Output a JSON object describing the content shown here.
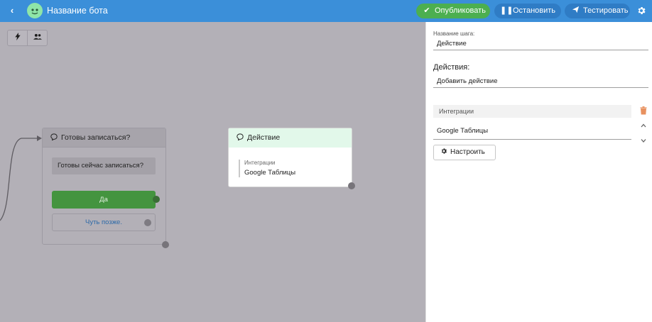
{
  "header": {
    "back_icon": "‹",
    "bot_name": "Название бота",
    "publish_label": "Опубликовать",
    "stop_label": "Остановить",
    "test_label": "Тестировать",
    "accent": "#3b8fd9",
    "publish_color": "#4caf50"
  },
  "toolbar": {
    "icons": [
      "lightning-icon",
      "users-icon"
    ]
  },
  "nodes": {
    "ready": {
      "title": "Готовы записаться?",
      "message": "Готовы сейчас записаться?",
      "yes_label": "Да",
      "later_label": "Чуть позже."
    },
    "action": {
      "title": "Действие",
      "integration_label": "Интеграции",
      "integration_value": "Google Таблицы"
    }
  },
  "panel": {
    "step_name_label": "Название шага:",
    "step_name_value": "Действие",
    "actions_label": "Действия:",
    "add_action": "Добавить действие",
    "integrations_label": "Интеграции",
    "integration_value": "Google Таблицы",
    "configure_label": "Настроить"
  }
}
